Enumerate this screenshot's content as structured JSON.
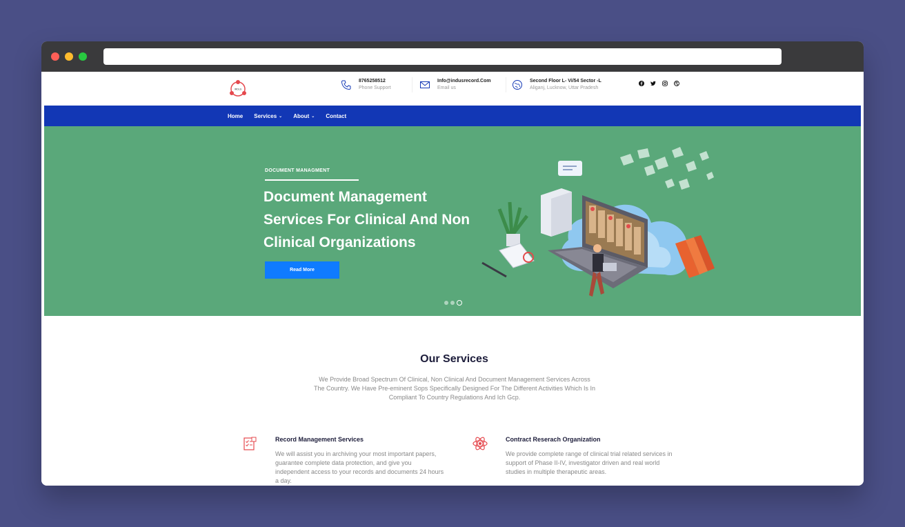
{
  "browser": {
    "url": ""
  },
  "header": {
    "phone": {
      "value": "8765258512",
      "label": "Phone Support",
      "icon": "phone-icon"
    },
    "email": {
      "value": "Info@indusrecord.Com",
      "label": "Email us",
      "icon": "mail-icon"
    },
    "address": {
      "value": "Second Floor L- Vi/54 Sector -L",
      "label": "Aliganj, Lucknow, Uttar Pradesh",
      "icon": "location-icon"
    },
    "socials": [
      "facebook-icon",
      "twitter-icon",
      "instagram-icon",
      "dribbble-icon"
    ]
  },
  "nav": {
    "items": [
      {
        "label": "Home"
      },
      {
        "label": "Services",
        "chevron": "⌄"
      },
      {
        "label": "About",
        "chevron": "⌄"
      },
      {
        "label": "Contact"
      }
    ]
  },
  "hero": {
    "eyebrow": "DOCUMENT MANAGMENT",
    "title": "Document Management Services For Clinical And Non Clinical Organizations",
    "cta": "Read More",
    "slides": 3,
    "active_slide": 3,
    "bg_color": "#5aa87a"
  },
  "services": {
    "title": "Our Services",
    "description": "We Provide Broad Spectrum Of Clinical, Non Clinical And Document Management Services Across The Country. We Have Pre-eminent Sops Specifically Designed For The Different Activities Which Is In Compliant To Country Regulations And Ich Gcp.",
    "items": [
      {
        "title": "Record Management Services",
        "text": "We will assist you in archiving your most important papers, guarantee complete data protection, and give you independent access to your records and documents 24 hours a day.",
        "icon": "checklist-icon"
      },
      {
        "title": "Contract Reserach Organization",
        "text": "We provide complete range of clinical trial related services in support of Phase II-IV, investigator driven and real world studies in multiple therapeutic areas.",
        "icon": "atom-icon"
      }
    ]
  },
  "colors": {
    "nav": "#1237b5",
    "accent": "#0f7bff",
    "brand_red": "#e5484d"
  }
}
